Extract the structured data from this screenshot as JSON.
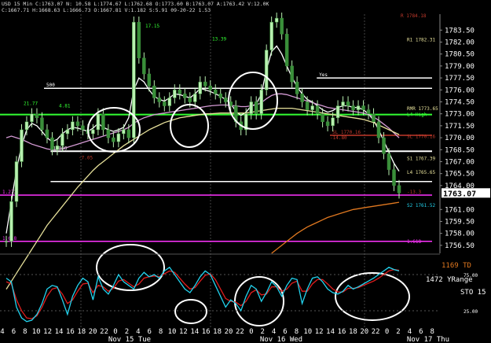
{
  "header": {
    "symbol_line": "USD 15 Min  C:1763.07  N:  10.58  L:1774.67  L:1762.68  O:1773.60  B:1763.07  A:1763.42  V:12.0K",
    "stats_line": "C:1667.71  H:1668.63  L:1666.73  O:1667.81  V:1.182  S:5.91  09-20-22  1.53"
  },
  "colors": {
    "background": "#000000",
    "price_bar": "#3a8f3a",
    "price_bar_light": "#b8f0b0",
    "ma_white": "#ffffff",
    "ma_pink": "#d49ad4",
    "ma_yellow": "#e6e09a",
    "ma_orange": "#e07820",
    "level_green": "#33ff33",
    "level_magenta": "#ff33ff",
    "level_white": "#ffffff",
    "level_red": "#c0392b",
    "sto_cyan": "#22d3ee",
    "sto_red": "#e11d1d",
    "last_price_bg": "#ffffff",
    "highlight_circle": "#ffffff"
  },
  "chart_data": {
    "type": "candlestick",
    "title": "",
    "ylim": [
      1755.5,
      1785.5
    ],
    "y_ticks": [
      "1783.50",
      "1782.00",
      "1780.50",
      "1779.00",
      "1777.50",
      "1776.00",
      "1774.50",
      "1773.00",
      "1771.50",
      "1770.00",
      "1768.50",
      "1767.00",
      "1765.50",
      "1764.00",
      "1761.00",
      "1759.50",
      "1758.00",
      "1756.50"
    ],
    "y_tick_values": [
      1783.5,
      1782.0,
      1780.5,
      1779.0,
      1777.5,
      1776.0,
      1774.5,
      1773.0,
      1771.5,
      1770.0,
      1768.5,
      1767.0,
      1765.5,
      1764.0,
      1761.0,
      1759.5,
      1758.0,
      1756.5
    ],
    "last_price": "1763.07",
    "last_price_value": 1763.07,
    "x_tick_labels": [
      "4",
      "6",
      "8",
      "10",
      "12",
      "14",
      "16",
      "18",
      "20",
      "22",
      "0",
      "2",
      "4",
      "6",
      "8",
      "10",
      "12",
      "14",
      "16",
      "18",
      "20",
      "22",
      "0",
      "2",
      "4",
      "6",
      "8",
      "10",
      "12",
      "14",
      "16",
      "18",
      "20",
      "22",
      "0",
      "2",
      "4",
      "6",
      "8"
    ],
    "date_labels": [
      "Nov 15 Tue",
      "Nov 16 Wed",
      "Nov 17 Thu"
    ],
    "price_path": [
      1757,
      1762,
      1767,
      1771,
      1772,
      1773,
      1772.5,
      1771,
      1770,
      1768.5,
      1769,
      1770.5,
      1771,
      1772,
      1771.5,
      1771,
      1770.5,
      1771,
      1773,
      1771,
      1770,
      1769.5,
      1770.5,
      1771,
      1770,
      1784.5,
      1780,
      1778,
      1776.5,
      1775,
      1774.5,
      1774,
      1775,
      1776,
      1775.5,
      1775,
      1774.5,
      1775.5,
      1777,
      1776.5,
      1776,
      1775.5,
      1775,
      1774.5,
      1774,
      1772,
      1771,
      1773,
      1774.5,
      1773,
      1776,
      1781,
      1784.5,
      1785,
      1783,
      1779,
      1777,
      1775.5,
      1774.5,
      1773.5,
      1774,
      1773,
      1772,
      1771.5,
      1772.5,
      1774,
      1774.5,
      1774,
      1773.5,
      1774,
      1773.5,
      1773,
      1772,
      1770,
      1768,
      1766,
      1764,
      1763.07
    ],
    "series": [
      {
        "name": "",
        "color_key": "ma_white",
        "values": [
          1758,
          1762,
          1766,
          1769,
          1771,
          1771.8,
          1771.5,
          1770.8,
          1770,
          1769.5,
          1769.8,
          1770.5,
          1771,
          1771.3,
          1771.2,
          1771,
          1770.8,
          1771.2,
          1771.8,
          1771.3,
          1771,
          1770.8,
          1771,
          1771.3,
          1772.5,
          1776,
          1777.5,
          1777,
          1776,
          1775.2,
          1774.8,
          1774.6,
          1775,
          1775.5,
          1775.4,
          1775.2,
          1775,
          1775.5,
          1776.2,
          1776,
          1775.8,
          1775.5,
          1775.2,
          1774.8,
          1774.3,
          1773.3,
          1772.8,
          1773.2,
          1774,
          1774.2,
          1775.5,
          1778.5,
          1780.8,
          1781.5,
          1780.5,
          1779,
          1777.6,
          1776.4,
          1775.5,
          1774.8,
          1774.5,
          1774,
          1773.5,
          1773.2,
          1773.4,
          1773.8,
          1774,
          1774,
          1773.8,
          1773.8,
          1773.5,
          1773,
          1772.2,
          1771,
          1769.6,
          1768.2,
          1766.8,
          1765.8
        ]
      },
      {
        "name": "",
        "color_key": "ma_pink",
        "values": [
          1770,
          1770.2,
          1770,
          1769.8,
          1769.5,
          1769.2,
          1769,
          1768.8,
          1768.6,
          1768.5,
          1768.5,
          1768.6,
          1768.8,
          1769,
          1769.2,
          1769.4,
          1769.6,
          1769.8,
          1770,
          1770.2,
          1770.4,
          1770.6,
          1770.8,
          1771,
          1771.3,
          1771.8,
          1772.2,
          1772.5,
          1772.7,
          1772.9,
          1773,
          1773.1,
          1773.2,
          1773.3,
          1773.4,
          1773.5,
          1773.6,
          1773.7,
          1773.8,
          1773.9,
          1774,
          1774.05,
          1774.1,
          1774.1,
          1774.05,
          1774,
          1773.9,
          1773.9,
          1774,
          1774.1,
          1774.4,
          1774.9,
          1775.3,
          1775.5,
          1775.5,
          1775.4,
          1775.2,
          1775,
          1774.8,
          1774.6,
          1774.4,
          1774.2,
          1774,
          1773.8,
          1773.7,
          1773.6,
          1773.5,
          1773.4,
          1773.3,
          1773.2,
          1773.1,
          1772.9,
          1772.6,
          1772.2,
          1771.7,
          1771.2,
          1770.6,
          1770
        ]
      },
      {
        "name": "",
        "color_key": "ma_yellow",
        "values": [
          1751,
          1752,
          1753,
          1754,
          1755,
          1756,
          1757,
          1758,
          1759,
          1759.8,
          1760.6,
          1761.4,
          1762.2,
          1763,
          1763.8,
          1764.5,
          1765.2,
          1765.9,
          1766.5,
          1767,
          1767.5,
          1768,
          1768.5,
          1769,
          1769.4,
          1769.8,
          1770.2,
          1770.6,
          1771,
          1771.3,
          1771.6,
          1771.9,
          1772.1,
          1772.3,
          1772.5,
          1772.6,
          1772.7,
          1772.8,
          1772.9,
          1773,
          1773,
          1773.05,
          1773.1,
          1773.1,
          1773.1,
          1773.1,
          1773.1,
          1773.1,
          1773.2,
          1773.3,
          1773.4,
          1773.5,
          1773.6,
          1773.7,
          1773.7,
          1773.7,
          1773.7,
          1773.6,
          1773.5,
          1773.4,
          1773.3,
          1773.2,
          1773.1,
          1773,
          1772.9,
          1772.8,
          1772.7,
          1772.6,
          1772.5,
          1772.4,
          1772.3,
          1772.1,
          1771.9,
          1771.6,
          1771.3,
          1771,
          1770.7,
          1770.4
        ]
      },
      {
        "name": "",
        "color_key": "ma_orange",
        "values": [
          null,
          null,
          null,
          null,
          null,
          null,
          null,
          null,
          null,
          null,
          null,
          null,
          null,
          null,
          null,
          null,
          null,
          null,
          null,
          null,
          null,
          null,
          null,
          null,
          null,
          null,
          null,
          null,
          null,
          null,
          null,
          null,
          null,
          null,
          null,
          null,
          null,
          null,
          null,
          null,
          null,
          null,
          null,
          null,
          null,
          null,
          null,
          null,
          null,
          null,
          null,
          null,
          1755.5,
          1756,
          1756.5,
          1757,
          1757.5,
          1758,
          1758.4,
          1758.8,
          1759.1,
          1759.4,
          1759.7,
          1760,
          1760.2,
          1760.4,
          1760.6,
          1760.8,
          1761,
          1761.1,
          1761.2,
          1761.3,
          1761.4,
          1761.5,
          1761.6,
          1761.7,
          1761.8,
          1761.9
        ]
      }
    ],
    "levels": [
      {
        "value": 1772.9,
        "color_key": "level_green",
        "label": "",
        "x_start": 0.0
      },
      {
        "value": 1768.3,
        "color_key": "level_white",
        "label": "1.000",
        "x_start": 0.115
      },
      {
        "value": 1762.8,
        "color_key": "level_magenta",
        "label": "1.272",
        "x_start": 0.0
      },
      {
        "value": 1757.0,
        "color_key": "level_magenta",
        "label": "1.618",
        "x_start": 0.0
      },
      {
        "value": 1770.3,
        "color_key": "level_red",
        "label": "SL 1770.16",
        "x_start": 0.75
      },
      {
        "value": 1777.5,
        "color_key": "level_white",
        "label": "Yes",
        "x_start": 0.72
      },
      {
        "value": 1776.2,
        "color_key": "level_white",
        "label": "500",
        "x_start": 0.1
      },
      {
        "value": 1764.5,
        "color_key": "level_white",
        "label": "",
        "x_start": 0.115
      }
    ],
    "annotations": [
      {
        "text": "R1 1782.31",
        "value": 1782.31,
        "color_key": "ma_yellow"
      },
      {
        "text": "RMR 1773.65",
        "value": 1773.65,
        "color_key": "ma_yellow"
      },
      {
        "text": "L4 High",
        "value": 1772.9,
        "color_key": "level_green"
      },
      {
        "text": "SL 1770.16",
        "value": 1770.16,
        "color_key": "level_red"
      },
      {
        "text": "S1 1767.39",
        "value": 1767.39,
        "color_key": "ma_yellow"
      },
      {
        "text": "L4 1765.65",
        "value": 1765.65,
        "color_key": "ma_yellow"
      },
      {
        "text": "S2 1761.52",
        "value": 1761.52,
        "color_key": "sto_cyan"
      },
      {
        "text": "-13.3",
        "value": 1763.2,
        "color_key": "level_red"
      },
      {
        "text": "1.618",
        "value": 1757.0,
        "color_key": "level_magenta"
      },
      {
        "text": "R 1784.18",
        "value": 1785.3,
        "color_key": "level_red"
      },
      {
        "text": "21.77",
        "value": 1774.3,
        "color_key": "level_green"
      },
      {
        "text": "4.81",
        "value": 1774.0,
        "color_key": "level_green"
      },
      {
        "text": "-7.05",
        "value": 1767.5,
        "color_key": "level_red"
      },
      {
        "text": "17.15",
        "value": 1784.0,
        "color_key": "level_green"
      },
      {
        "text": "13.39",
        "value": 1782.4,
        "color_key": "level_green"
      },
      {
        "text": "-14.80",
        "value": 1770.0,
        "color_key": "level_red"
      }
    ],
    "indicator": {
      "name": "STO",
      "label_td": "1169 TD",
      "label_range": "1472 YRange",
      "label_sto": "STO 15",
      "y_ticks": [
        "25.00",
        "75.00"
      ],
      "ylim": [
        0,
        100
      ],
      "k_values": [
        70,
        65,
        30,
        15,
        10,
        12,
        20,
        35,
        55,
        60,
        58,
        40,
        20,
        45,
        60,
        70,
        65,
        40,
        72,
        55,
        48,
        60,
        75,
        65,
        60,
        55,
        70,
        78,
        72,
        75,
        70,
        80,
        85,
        75,
        65,
        55,
        50,
        60,
        72,
        80,
        75,
        60,
        45,
        30,
        40,
        35,
        25,
        45,
        60,
        55,
        38,
        50,
        65,
        58,
        45,
        60,
        70,
        68,
        35,
        55,
        70,
        72,
        65,
        55,
        50,
        48,
        52,
        60,
        55,
        58,
        62,
        66,
        70,
        75,
        80,
        85,
        82,
        80
      ],
      "d_values": [
        65,
        62,
        40,
        25,
        15,
        14,
        18,
        30,
        45,
        55,
        57,
        48,
        35,
        40,
        52,
        62,
        63,
        50,
        60,
        58,
        52,
        56,
        66,
        68,
        63,
        58,
        62,
        70,
        72,
        73,
        72,
        76,
        80,
        78,
        70,
        62,
        55,
        57,
        66,
        74,
        76,
        68,
        55,
        42,
        38,
        37,
        32,
        38,
        50,
        54,
        47,
        48,
        58,
        58,
        52,
        55,
        63,
        66,
        52,
        52,
        62,
        68,
        68,
        62,
        55,
        51,
        51,
        56,
        56,
        57,
        60,
        63,
        66,
        70,
        75,
        80,
        82,
        81
      ]
    },
    "highlight_circles": [
      "consolidation 1",
      "consolidation 2",
      "consolidation 3",
      "sto 1",
      "sto 2",
      "sto 3",
      "sto 4"
    ]
  }
}
